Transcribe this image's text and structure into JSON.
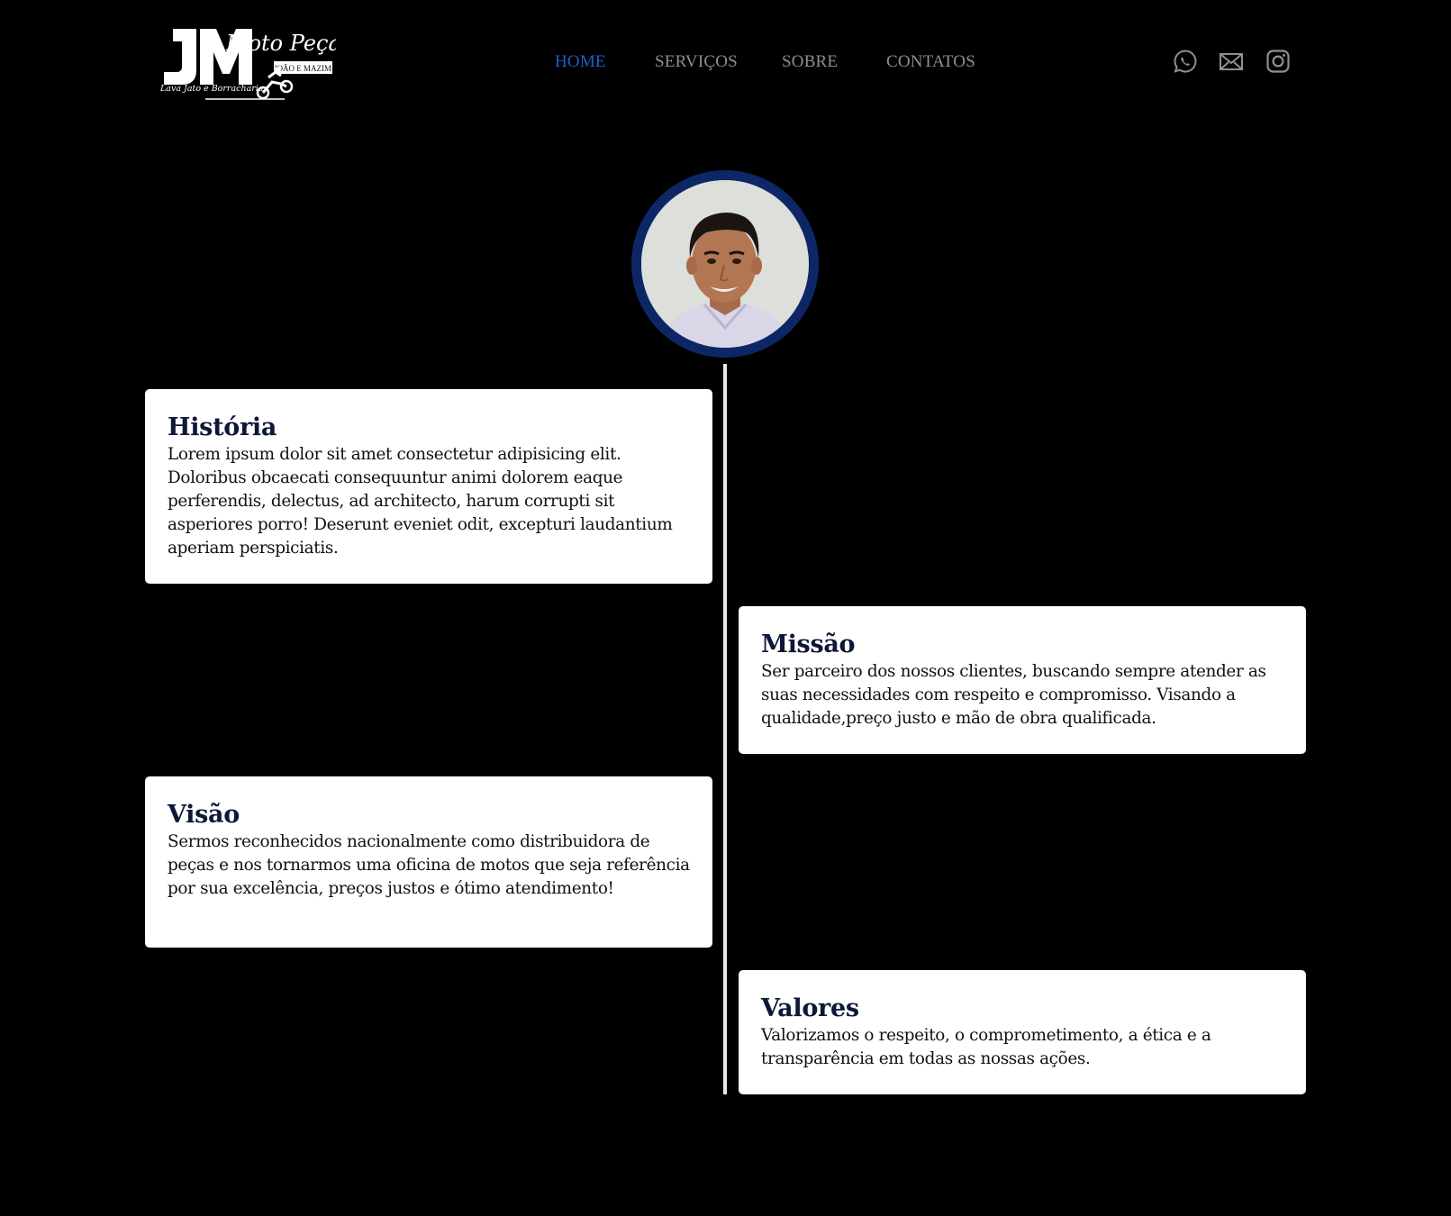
{
  "header": {
    "logo": {
      "initials": "JM",
      "title": "Moto Peças",
      "owners": "JOÃO E MAZIM",
      "tagline": "Lava Jato e Borracharia"
    },
    "nav": [
      {
        "label": "HOME",
        "active": true
      },
      {
        "label": "SERVIÇOS",
        "active": false
      },
      {
        "label": "SOBRE",
        "active": false
      },
      {
        "label": "CONTATOS",
        "active": false
      }
    ],
    "social_icons": [
      "whatsapp-icon",
      "mail-icon",
      "instagram-icon"
    ]
  },
  "timeline": {
    "cards": [
      {
        "title": "História",
        "text": "Lorem ipsum dolor sit amet consectetur adipisicing elit. Doloribus obcaecati consequuntur animi dolorem eaque perferendis, delectus, ad architecto, harum corrupti sit asperiores porro! Deserunt eveniet odit, excepturi laudantium aperiam perspiciatis."
      },
      {
        "title": "Missão",
        "text": "Ser parceiro dos nossos clientes, buscando sempre atender as suas necessidades com respeito e compromisso. Visando a qualidade,preço justo e mão de obra qualificada."
      },
      {
        "title": "Visão",
        "text": "Sermos reconhecidos nacionalmente como distribuidora de peças e nos tornarmos uma oficina de motos que seja referência por sua excelência, preços justos e ótimo atendimento!"
      },
      {
        "title": "Valores",
        "text": "Valorizamos o respeito, o comprometimento, a ética e a transparência em todas as nossas ações."
      }
    ]
  },
  "colors": {
    "background": "#000000",
    "nav_active": "#1f5fbf",
    "nav_inactive": "#8f8f8f",
    "ring": "#0d2766",
    "card_bg": "#ffffff",
    "card_title": "#0c1836"
  }
}
